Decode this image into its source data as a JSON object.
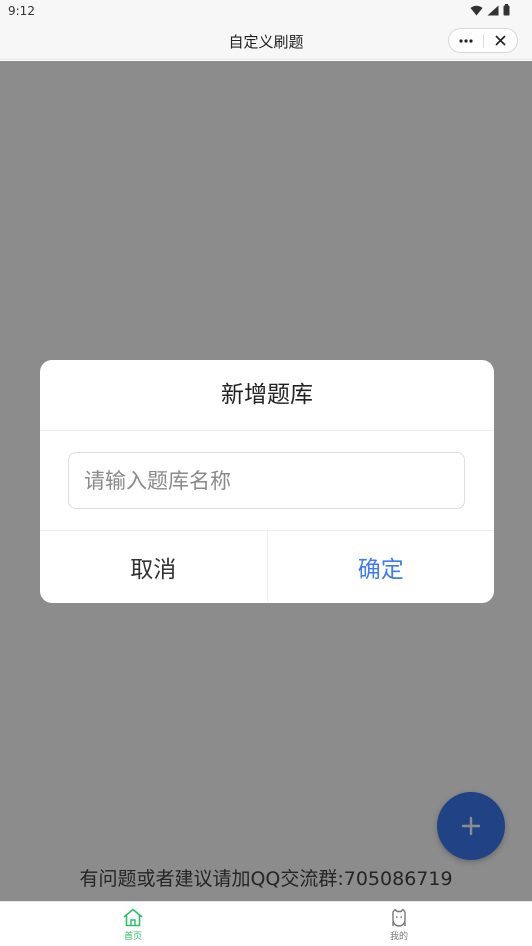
{
  "status_bar": {
    "time": "9:12"
  },
  "nav_bar": {
    "title": "自定义刷题"
  },
  "footer": {
    "note": "有问题或者建议请加QQ交流群:705086719"
  },
  "modal": {
    "title": "新增题库",
    "input_placeholder": "请输入题库名称",
    "input_value": "",
    "cancel_label": "取消",
    "confirm_label": "确定"
  },
  "tab_bar": {
    "items": [
      {
        "label": "首页",
        "icon": "home-icon",
        "active": true
      },
      {
        "label": "我的",
        "icon": "profile-icon",
        "active": false
      }
    ]
  },
  "colors": {
    "accent": "#3d7bf2",
    "tab_active": "#2bbf6a",
    "overlay": "rgba(0,0,0,0.45)"
  }
}
